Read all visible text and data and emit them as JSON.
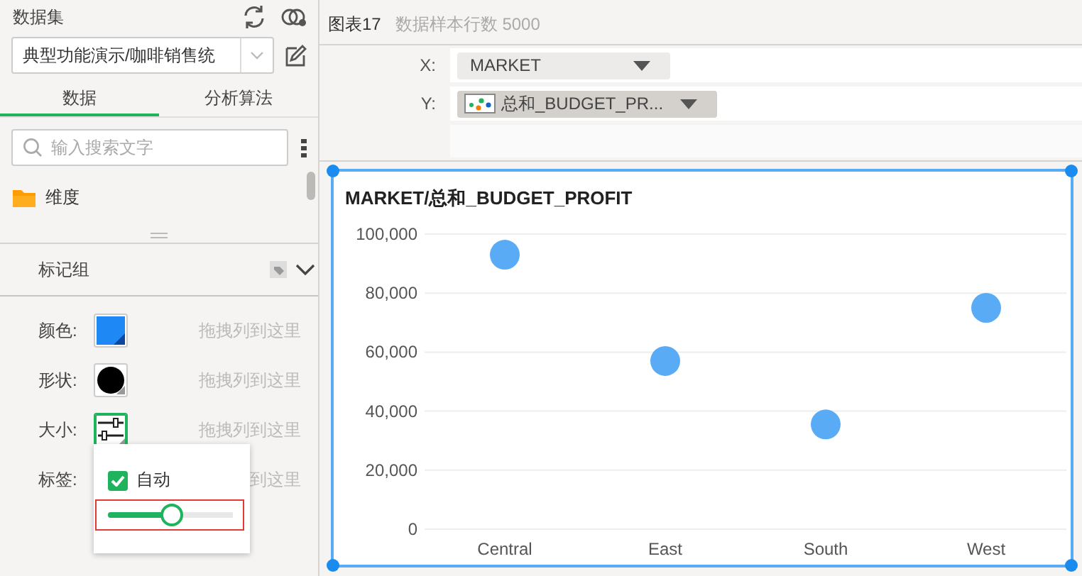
{
  "dataset": {
    "title": "数据集",
    "value": "典型功能演示/咖啡销售统"
  },
  "tabs": [
    {
      "label": "数据",
      "selected": true
    },
    {
      "label": "分析算法",
      "selected": false
    }
  ],
  "search": {
    "placeholder": "输入搜索文字"
  },
  "tree": [
    {
      "label": "维度"
    }
  ],
  "marks": {
    "title": "标记组",
    "expanded": true,
    "rows": [
      {
        "kind": "color",
        "label": "颜色:",
        "hint": "拖拽列到这里",
        "selected": false
      },
      {
        "kind": "shape",
        "label": "形状:",
        "hint": "拖拽列到这里",
        "selected": false
      },
      {
        "kind": "size",
        "label": "大小:",
        "hint": "拖拽列到这里",
        "selected": true
      },
      {
        "kind": "text",
        "label": "标签:",
        "hint": "到这里"
      }
    ]
  },
  "size_popup": {
    "label": "自动",
    "checked": true,
    "level": 0.5
  },
  "chart_header": {
    "name": "图表17",
    "info": "数据样本行数 5000"
  },
  "axes": [
    {
      "kind": "dimension",
      "label": "X:",
      "field": "MARKET"
    },
    {
      "kind": "measure",
      "label": "Y:",
      "field": "总和_BUDGET_PR..."
    }
  ],
  "chart": {
    "chart_data": {
      "type": "scatter",
      "title": "MARKET/总和_BUDGET_PROFIT",
      "categories": [
        "Central",
        "East",
        "South",
        "West"
      ],
      "series": [
        {
          "color": "#5aabf5",
          "values": [
            93000,
            57000,
            35500,
            75000
          ]
        }
      ],
      "grid": true,
      "ylim": [
        0,
        100000
      ],
      "yticks": [
        {
          "value": 0,
          "label": "0"
        },
        {
          "value": 20000,
          "label": "20,000"
        },
        {
          "value": 40000,
          "label": "40,000"
        },
        {
          "value": 60000,
          "label": "60,000"
        },
        {
          "value": 80000,
          "label": "80,000"
        },
        {
          "value": 100000,
          "label": "100,000"
        }
      ]
    }
  }
}
